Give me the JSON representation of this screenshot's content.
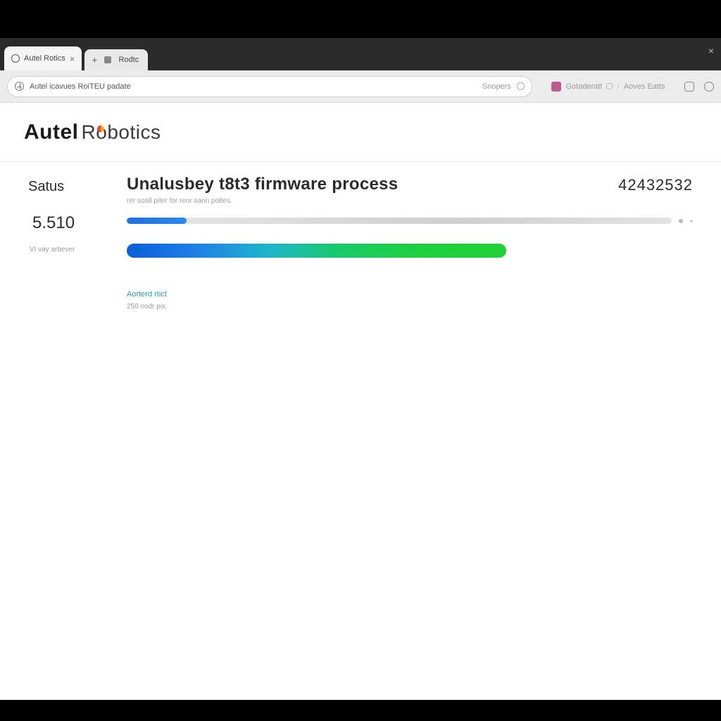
{
  "browser": {
    "tabs": [
      {
        "icon": "globe",
        "label": "Autel Rotics",
        "close": "×"
      }
    ],
    "secondary_tab": {
      "plus": "+",
      "label": "Rodtc"
    },
    "window_close": "×"
  },
  "toolbar": {
    "address": {
      "text": "Autel icavues RoiTEU padate",
      "suffix": "Snopers"
    },
    "breadcrumb": {
      "a": "Gotaderatt",
      "sep": "›",
      "b": "Aoves  Eatts"
    }
  },
  "brand": {
    "main_a": "Aut",
    "main_b": "el",
    "sub_pre": "R",
    "sub_o": "o",
    "sub_rest": "botics"
  },
  "side": {
    "heading": "Satus",
    "number": "5.510",
    "caption": "VI vay arbever"
  },
  "main": {
    "title": "Unalusbey t8t3 firmware process",
    "subtitle": "rer soall piter for reor sann poltes.",
    "count": "42432532",
    "progress_a_pct": 11,
    "progress_b_pct": 67,
    "meta_link": "Aorterd rtict",
    "meta_sub": "250 nodr pix."
  }
}
